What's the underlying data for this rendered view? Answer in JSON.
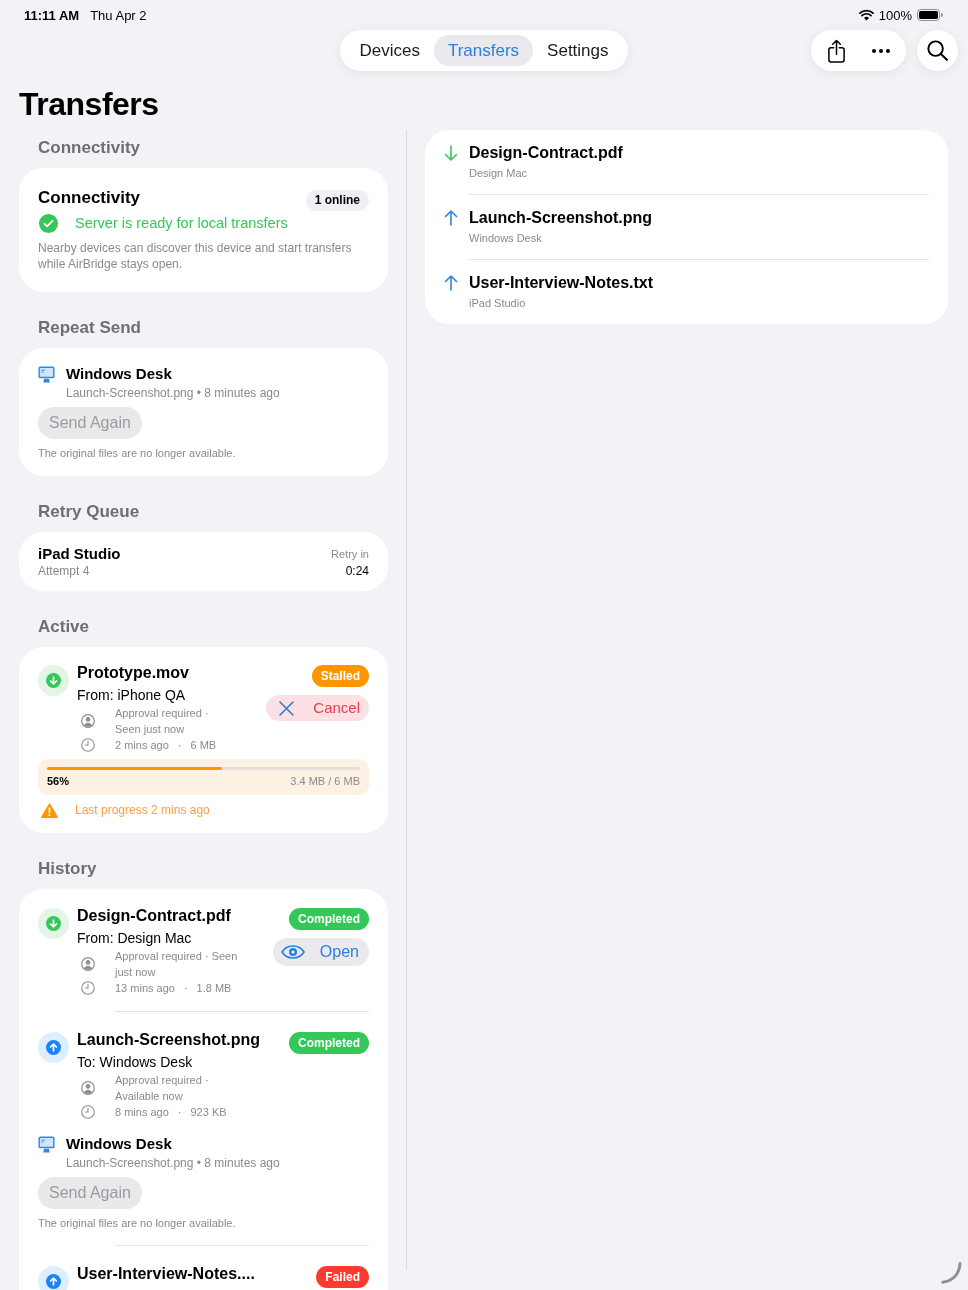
{
  "status_bar": {
    "time": "11:11 AM",
    "date": "Thu Apr 2",
    "battery_percent": "100%"
  },
  "tabs": [
    {
      "label": "Devices",
      "selected": false
    },
    {
      "label": "Transfers",
      "selected": true
    },
    {
      "label": "Settings",
      "selected": false
    }
  ],
  "title": "Transfers",
  "connectivity": {
    "heading": "Connectivity",
    "title": "Connectivity",
    "badge": "1 online",
    "ready": true,
    "status": "Server is ready for local transfers",
    "description": "Nearby devices can discover this device and start transfers while AirBridge stays open."
  },
  "repeat_send": {
    "heading": "Repeat Send",
    "device": "Windows Desk",
    "detail": "Launch-Screenshot.png • 8 minutes ago",
    "button": {
      "label": "Send Again",
      "disabled": true
    },
    "note": "The original files are no longer available."
  },
  "retry_queue": {
    "heading": "Retry Queue",
    "items": [
      {
        "device": "iPad Studio",
        "attempt": "Attempt 4",
        "retry_label": "Retry in",
        "countdown": "0:24"
      }
    ]
  },
  "active": {
    "heading": "Active",
    "items": [
      {
        "kind": "incoming",
        "name": "Prototype.mov",
        "peer": "From: iPhone QA",
        "approval": "Approval required · Seen just now",
        "time": "2 mins ago",
        "separator": "·",
        "size": "6 MB",
        "status": {
          "label": "Stalled",
          "kind": "stalled"
        },
        "action": {
          "label": "Cancel",
          "kind": "cancel"
        },
        "progress": {
          "level": 0.56,
          "percent": "56%",
          "amount": "3.4 MB / 6 MB"
        },
        "warning": "Last progress 2 mins ago"
      }
    ]
  },
  "history": {
    "heading": "History",
    "items": [
      {
        "kind": "incoming",
        "name": "Design-Contract.pdf",
        "peer": "From: Design Mac",
        "approval": "Approval required · Seen just now",
        "time": "13 mins ago",
        "separator": "·",
        "size": "1.8 MB",
        "status": {
          "label": "Completed",
          "kind": "completed"
        },
        "action": {
          "label": "Open",
          "kind": "open"
        }
      },
      {
        "kind": "outgoing",
        "name": "Launch-Screenshot.png",
        "peer": "To: Windows Desk",
        "approval": "Approval required · Available now",
        "time": "8 mins ago",
        "separator": "·",
        "size": "923 KB",
        "status": {
          "label": "Completed",
          "kind": "completed"
        },
        "repeat_send": {
          "device": "Windows Desk",
          "detail": "Launch-Screenshot.png • 8 minutes ago",
          "button": {
            "label": "Send Again",
            "disabled": true
          },
          "note": "The original files are no longer available."
        }
      },
      {
        "kind": "outgoing",
        "name": "User-Interview-Notes....",
        "status": {
          "label": "Failed",
          "kind": "failed"
        }
      }
    ]
  },
  "recent": [
    {
      "kind": "incoming",
      "name": "Design-Contract.pdf",
      "peer": "Design Mac"
    },
    {
      "kind": "outgoing",
      "name": "Launch-Screenshot.png",
      "peer": "Windows Desk"
    },
    {
      "kind": "outgoing",
      "name": "User-Interview-Notes.txt",
      "peer": "iPad Studio"
    }
  ]
}
